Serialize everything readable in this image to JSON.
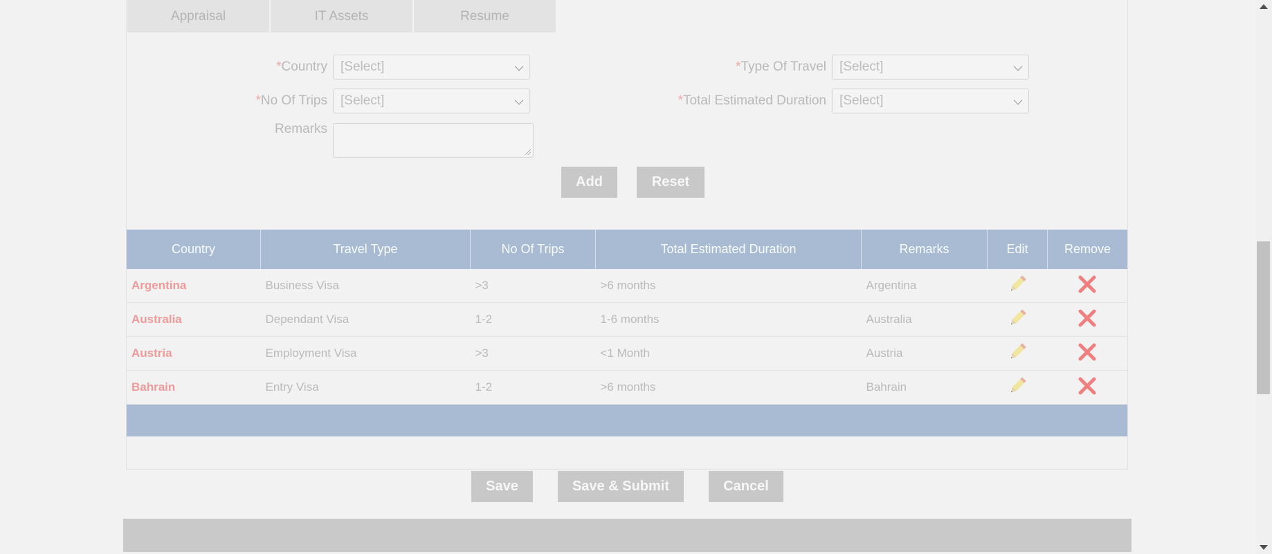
{
  "tabs": [
    {
      "label": "Appraisal"
    },
    {
      "label": "IT Assets"
    },
    {
      "label": "Resume"
    }
  ],
  "form": {
    "required_mark": "*",
    "country_label": "Country",
    "country_value": "[Select]",
    "travel_type_label": "Type Of Travel",
    "travel_type_value": "[Select]",
    "trips_label": "No Of Trips",
    "trips_value": "[Select]",
    "duration_label": "Total Estimated Duration",
    "duration_value": "[Select]",
    "remarks_label": "Remarks",
    "remarks_value": "",
    "add_label": "Add",
    "reset_label": "Reset"
  },
  "table": {
    "columns": [
      "Country",
      "Travel Type",
      "No Of Trips",
      "Total Estimated Duration",
      "Remarks",
      "Edit",
      "Remove"
    ],
    "rows": [
      {
        "country": "Argentina",
        "travel_type": "Business Visa",
        "trips": ">3",
        "duration": ">6 months",
        "remarks": "Argentina"
      },
      {
        "country": "Australia",
        "travel_type": "Dependant Visa",
        "trips": "1-2",
        "duration": "1-6 months",
        "remarks": "Australia"
      },
      {
        "country": "Austria",
        "travel_type": "Employment Visa",
        "trips": ">3",
        "duration": "<1 Month",
        "remarks": "Austria"
      },
      {
        "country": "Bahrain",
        "travel_type": "Entry Visa",
        "trips": "1-2",
        "duration": ">6 months",
        "remarks": "Bahrain"
      }
    ]
  },
  "actions": {
    "save_label": "Save",
    "save_submit_label": "Save & Submit",
    "cancel_label": "Cancel"
  },
  "icons": {
    "edit": "pencil-icon",
    "remove": "close-icon"
  },
  "colors": {
    "table_header": "#a8bbd3",
    "country_text": "#ef9a9a",
    "remove_icon": "#f08080",
    "button_bg": "#c8c8c8"
  }
}
